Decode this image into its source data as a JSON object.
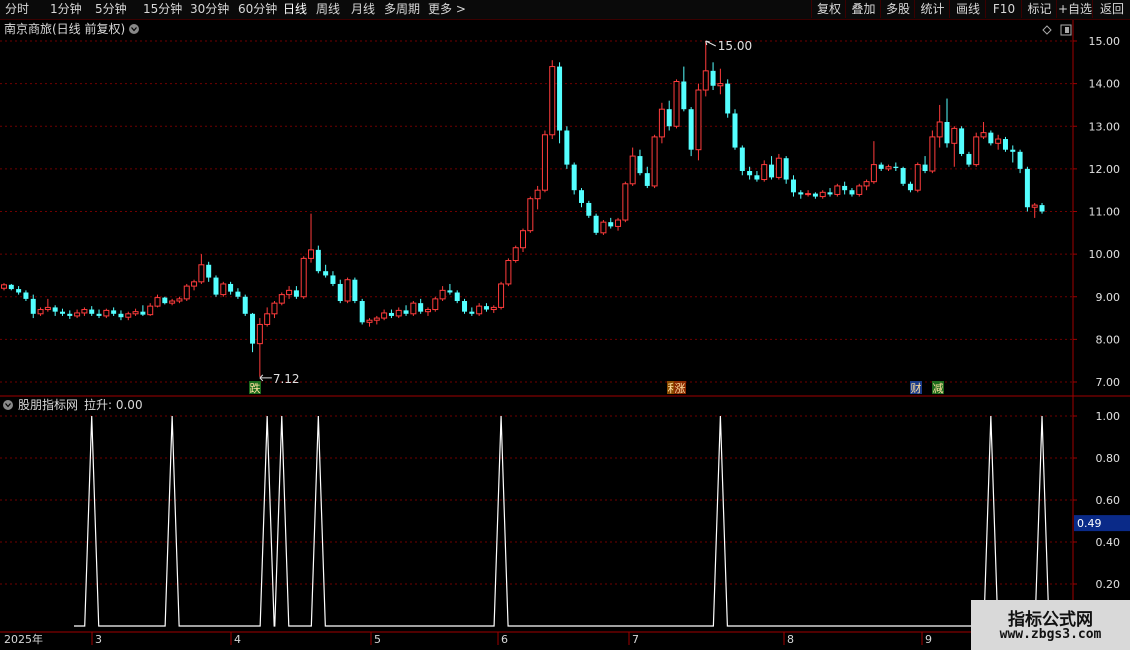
{
  "toolbar": {
    "left": [
      {
        "label": "分时"
      },
      {
        "label": "1分钟"
      },
      {
        "label": "5分钟"
      },
      {
        "label": "15分钟"
      },
      {
        "label": "30分钟"
      },
      {
        "label": "60分钟"
      },
      {
        "label": "日线",
        "active": true
      },
      {
        "label": "周线"
      },
      {
        "label": "月线"
      },
      {
        "label": "多周期"
      },
      {
        "label": "更多 >"
      }
    ],
    "right": [
      {
        "label": "复权"
      },
      {
        "label": "叠加"
      },
      {
        "label": "多股"
      },
      {
        "label": "统计"
      },
      {
        "label": "画线"
      },
      {
        "label": "F10"
      },
      {
        "label": "标记"
      },
      {
        "label": "+自选"
      },
      {
        "label": "返回"
      }
    ]
  },
  "main_chart": {
    "title": "南京商旅(日线 前复权)",
    "high_label": "15.00",
    "low_label": "7.12",
    "badges": [
      {
        "text": "跌",
        "color": "#1c6b1c"
      },
      {
        "text": "利",
        "color": "#8a4a00"
      },
      {
        "text": "涨",
        "color": "#8a2a00"
      },
      {
        "text": "财",
        "color": "#1c3c8a"
      },
      {
        "text": "减",
        "color": "#1c6b1c"
      }
    ],
    "yticks": [
      "15.00",
      "14.00",
      "13.00",
      "12.00",
      "11.00",
      "10.00",
      "9.00",
      "8.00",
      "7.00"
    ]
  },
  "indicator": {
    "title": "股朋指标网",
    "value_label": "拉升: 0.00",
    "current_value": "0.49",
    "yticks": [
      "1.00",
      "0.80",
      "0.60",
      "0.40",
      "0.20"
    ]
  },
  "x_axis": {
    "labels": [
      "2025年",
      "3",
      "4",
      "5",
      "6",
      "7",
      "8",
      "9"
    ]
  },
  "watermark": {
    "line1": "指标公式网",
    "line2": "www.zbgs3.com"
  },
  "colors": {
    "up": "#ff3c3c",
    "down": "#54ffff",
    "grid": "#700000",
    "axis": "#a00000"
  },
  "chart_data": {
    "type": "candlestick",
    "ylim": [
      7.0,
      15.3
    ],
    "ohlc": [
      [
        9.2,
        9.32,
        9.15,
        9.28
      ],
      [
        9.28,
        9.3,
        9.15,
        9.18
      ],
      [
        9.18,
        9.25,
        9.05,
        9.1
      ],
      [
        9.1,
        9.15,
        8.9,
        8.95
      ],
      [
        8.95,
        9.05,
        8.5,
        8.6
      ],
      [
        8.6,
        8.75,
        8.55,
        8.7
      ],
      [
        8.7,
        8.95,
        8.65,
        8.75
      ],
      [
        8.75,
        8.8,
        8.55,
        8.65
      ],
      [
        8.65,
        8.72,
        8.55,
        8.6
      ],
      [
        8.6,
        8.68,
        8.48,
        8.55
      ],
      [
        8.55,
        8.7,
        8.5,
        8.62
      ],
      [
        8.62,
        8.75,
        8.55,
        8.7
      ],
      [
        8.7,
        8.78,
        8.55,
        8.6
      ],
      [
        8.6,
        8.7,
        8.5,
        8.55
      ],
      [
        8.55,
        8.72,
        8.5,
        8.68
      ],
      [
        8.68,
        8.75,
        8.55,
        8.6
      ],
      [
        8.6,
        8.68,
        8.45,
        8.52
      ],
      [
        8.52,
        8.65,
        8.45,
        8.6
      ],
      [
        8.6,
        8.72,
        8.55,
        8.65
      ],
      [
        8.65,
        8.8,
        8.55,
        8.58
      ],
      [
        8.58,
        8.85,
        8.55,
        8.78
      ],
      [
        8.78,
        9.05,
        8.75,
        8.98
      ],
      [
        8.98,
        9.0,
        8.82,
        8.85
      ],
      [
        8.85,
        8.95,
        8.8,
        8.9
      ],
      [
        8.9,
        9.0,
        8.85,
        8.95
      ],
      [
        8.95,
        9.3,
        8.9,
        9.25
      ],
      [
        9.25,
        9.4,
        9.15,
        9.35
      ],
      [
        9.35,
        10.0,
        9.3,
        9.75
      ],
      [
        9.75,
        9.82,
        9.35,
        9.45
      ],
      [
        9.45,
        9.5,
        9.0,
        9.05
      ],
      [
        9.05,
        9.35,
        9.0,
        9.3
      ],
      [
        9.3,
        9.35,
        9.05,
        9.12
      ],
      [
        9.12,
        9.2,
        8.95,
        9.0
      ],
      [
        9.0,
        9.05,
        8.55,
        8.6
      ],
      [
        8.6,
        8.62,
        7.7,
        7.9
      ],
      [
        7.9,
        8.5,
        7.12,
        8.35
      ],
      [
        8.35,
        8.75,
        8.3,
        8.6
      ],
      [
        8.6,
        8.9,
        8.5,
        8.85
      ],
      [
        8.85,
        9.1,
        8.8,
        9.05
      ],
      [
        9.05,
        9.25,
        8.95,
        9.15
      ],
      [
        9.15,
        9.25,
        8.95,
        9.0
      ],
      [
        9.0,
        9.95,
        8.95,
        9.9
      ],
      [
        9.9,
        10.95,
        9.8,
        10.1
      ],
      [
        10.1,
        10.2,
        9.55,
        9.6
      ],
      [
        9.6,
        9.75,
        9.45,
        9.5
      ],
      [
        9.5,
        9.6,
        9.25,
        9.3
      ],
      [
        9.3,
        9.4,
        8.85,
        8.9
      ],
      [
        8.9,
        9.45,
        8.85,
        9.4
      ],
      [
        9.4,
        9.45,
        8.85,
        8.9
      ],
      [
        8.9,
        8.95,
        8.35,
        8.4
      ],
      [
        8.4,
        8.5,
        8.3,
        8.45
      ],
      [
        8.45,
        8.55,
        8.35,
        8.5
      ],
      [
        8.5,
        8.7,
        8.45,
        8.62
      ],
      [
        8.62,
        8.7,
        8.5,
        8.55
      ],
      [
        8.55,
        8.75,
        8.5,
        8.68
      ],
      [
        8.68,
        8.8,
        8.55,
        8.6
      ],
      [
        8.6,
        8.9,
        8.55,
        8.85
      ],
      [
        8.85,
        8.95,
        8.6,
        8.65
      ],
      [
        8.65,
        8.75,
        8.55,
        8.7
      ],
      [
        8.7,
        9.0,
        8.65,
        8.95
      ],
      [
        8.95,
        9.25,
        8.9,
        9.15
      ],
      [
        9.15,
        9.3,
        9.05,
        9.1
      ],
      [
        9.1,
        9.15,
        8.85,
        8.9
      ],
      [
        8.9,
        8.95,
        8.6,
        8.65
      ],
      [
        8.65,
        8.75,
        8.55,
        8.6
      ],
      [
        8.6,
        8.85,
        8.55,
        8.78
      ],
      [
        8.78,
        8.85,
        8.65,
        8.7
      ],
      [
        8.7,
        8.8,
        8.62,
        8.75
      ],
      [
        8.75,
        9.35,
        8.7,
        9.3
      ],
      [
        9.3,
        9.9,
        9.25,
        9.85
      ],
      [
        9.85,
        10.2,
        9.8,
        10.15
      ],
      [
        10.15,
        10.6,
        10.05,
        10.55
      ],
      [
        10.55,
        11.35,
        10.5,
        11.3
      ],
      [
        11.3,
        11.6,
        11.05,
        11.5
      ],
      [
        11.5,
        12.9,
        11.45,
        12.8
      ],
      [
        12.8,
        14.55,
        12.7,
        14.4
      ],
      [
        14.4,
        14.5,
        12.6,
        12.9
      ],
      [
        12.9,
        13.0,
        12.0,
        12.1
      ],
      [
        12.1,
        12.15,
        11.4,
        11.5
      ],
      [
        11.5,
        11.55,
        11.1,
        11.2
      ],
      [
        11.2,
        11.25,
        10.85,
        10.9
      ],
      [
        10.9,
        10.95,
        10.45,
        10.5
      ],
      [
        10.5,
        10.8,
        10.45,
        10.75
      ],
      [
        10.75,
        10.85,
        10.6,
        10.65
      ],
      [
        10.65,
        10.85,
        10.55,
        10.8
      ],
      [
        10.8,
        11.7,
        10.75,
        11.65
      ],
      [
        11.65,
        12.5,
        11.6,
        12.3
      ],
      [
        12.3,
        12.45,
        11.85,
        11.9
      ],
      [
        11.9,
        12.05,
        11.55,
        11.6
      ],
      [
        11.6,
        12.8,
        11.55,
        12.75
      ],
      [
        12.75,
        13.55,
        12.6,
        13.4
      ],
      [
        13.4,
        13.6,
        12.9,
        13.0
      ],
      [
        13.0,
        14.1,
        12.95,
        14.05
      ],
      [
        14.05,
        14.4,
        13.35,
        13.4
      ],
      [
        13.4,
        13.45,
        12.3,
        12.45
      ],
      [
        12.45,
        14.0,
        12.2,
        13.85
      ],
      [
        13.85,
        15.0,
        13.7,
        14.3
      ],
      [
        14.3,
        14.5,
        13.85,
        13.95
      ],
      [
        13.95,
        14.35,
        13.75,
        14.0
      ],
      [
        14.0,
        14.1,
        13.2,
        13.3
      ],
      [
        13.3,
        13.4,
        12.45,
        12.5
      ],
      [
        12.5,
        12.55,
        11.85,
        11.95
      ],
      [
        11.95,
        12.05,
        11.75,
        11.85
      ],
      [
        11.85,
        11.95,
        11.7,
        11.75
      ],
      [
        11.75,
        12.2,
        11.7,
        12.1
      ],
      [
        12.1,
        12.3,
        11.75,
        11.8
      ],
      [
        11.8,
        12.35,
        11.75,
        12.25
      ],
      [
        12.25,
        12.3,
        11.65,
        11.75
      ],
      [
        11.75,
        11.85,
        11.35,
        11.45
      ],
      [
        11.45,
        11.5,
        11.3,
        11.4
      ],
      [
        11.4,
        11.5,
        11.35,
        11.42
      ],
      [
        11.42,
        11.45,
        11.3,
        11.35
      ],
      [
        11.35,
        11.5,
        11.3,
        11.45
      ],
      [
        11.45,
        11.55,
        11.35,
        11.4
      ],
      [
        11.4,
        11.65,
        11.35,
        11.6
      ],
      [
        11.6,
        11.7,
        11.4,
        11.5
      ],
      [
        11.5,
        11.55,
        11.35,
        11.4
      ],
      [
        11.4,
        11.65,
        11.35,
        11.6
      ],
      [
        11.6,
        11.75,
        11.5,
        11.7
      ],
      [
        11.7,
        12.65,
        11.65,
        12.1
      ],
      [
        12.1,
        12.15,
        11.95,
        12.0
      ],
      [
        12.0,
        12.1,
        11.95,
        12.05
      ],
      [
        12.05,
        12.15,
        11.95,
        12.02
      ],
      [
        12.02,
        12.05,
        11.6,
        11.65
      ],
      [
        11.65,
        11.7,
        11.45,
        11.5
      ],
      [
        11.5,
        12.15,
        11.45,
        12.1
      ],
      [
        12.1,
        12.3,
        11.9,
        11.95
      ],
      [
        11.95,
        12.9,
        11.9,
        12.75
      ],
      [
        12.75,
        13.5,
        12.5,
        13.1
      ],
      [
        13.1,
        13.65,
        12.5,
        12.6
      ],
      [
        12.6,
        13.0,
        12.05,
        12.95
      ],
      [
        12.95,
        13.0,
        12.3,
        12.35
      ],
      [
        12.35,
        12.4,
        12.05,
        12.1
      ],
      [
        12.1,
        12.85,
        12.05,
        12.75
      ],
      [
        12.75,
        13.1,
        12.7,
        12.85
      ],
      [
        12.85,
        12.9,
        12.55,
        12.6
      ],
      [
        12.6,
        12.8,
        12.45,
        12.7
      ],
      [
        12.7,
        12.75,
        12.4,
        12.45
      ],
      [
        12.45,
        12.55,
        12.15,
        12.4
      ],
      [
        12.4,
        12.45,
        11.9,
        12.0
      ],
      [
        12.0,
        12.05,
        11.0,
        11.1
      ],
      [
        11.1,
        11.2,
        10.85,
        11.15
      ],
      [
        11.15,
        11.2,
        10.95,
        11.0
      ]
    ],
    "indicator_series": {
      "name": "拉升",
      "baseline": 0,
      "spike_days": [
        12,
        23,
        36,
        38,
        43,
        68,
        98,
        135,
        142
      ],
      "spike_value": 1.0
    },
    "yticks_indicator": [
      1.0,
      0.8,
      0.6,
      0.4,
      0.2
    ]
  }
}
